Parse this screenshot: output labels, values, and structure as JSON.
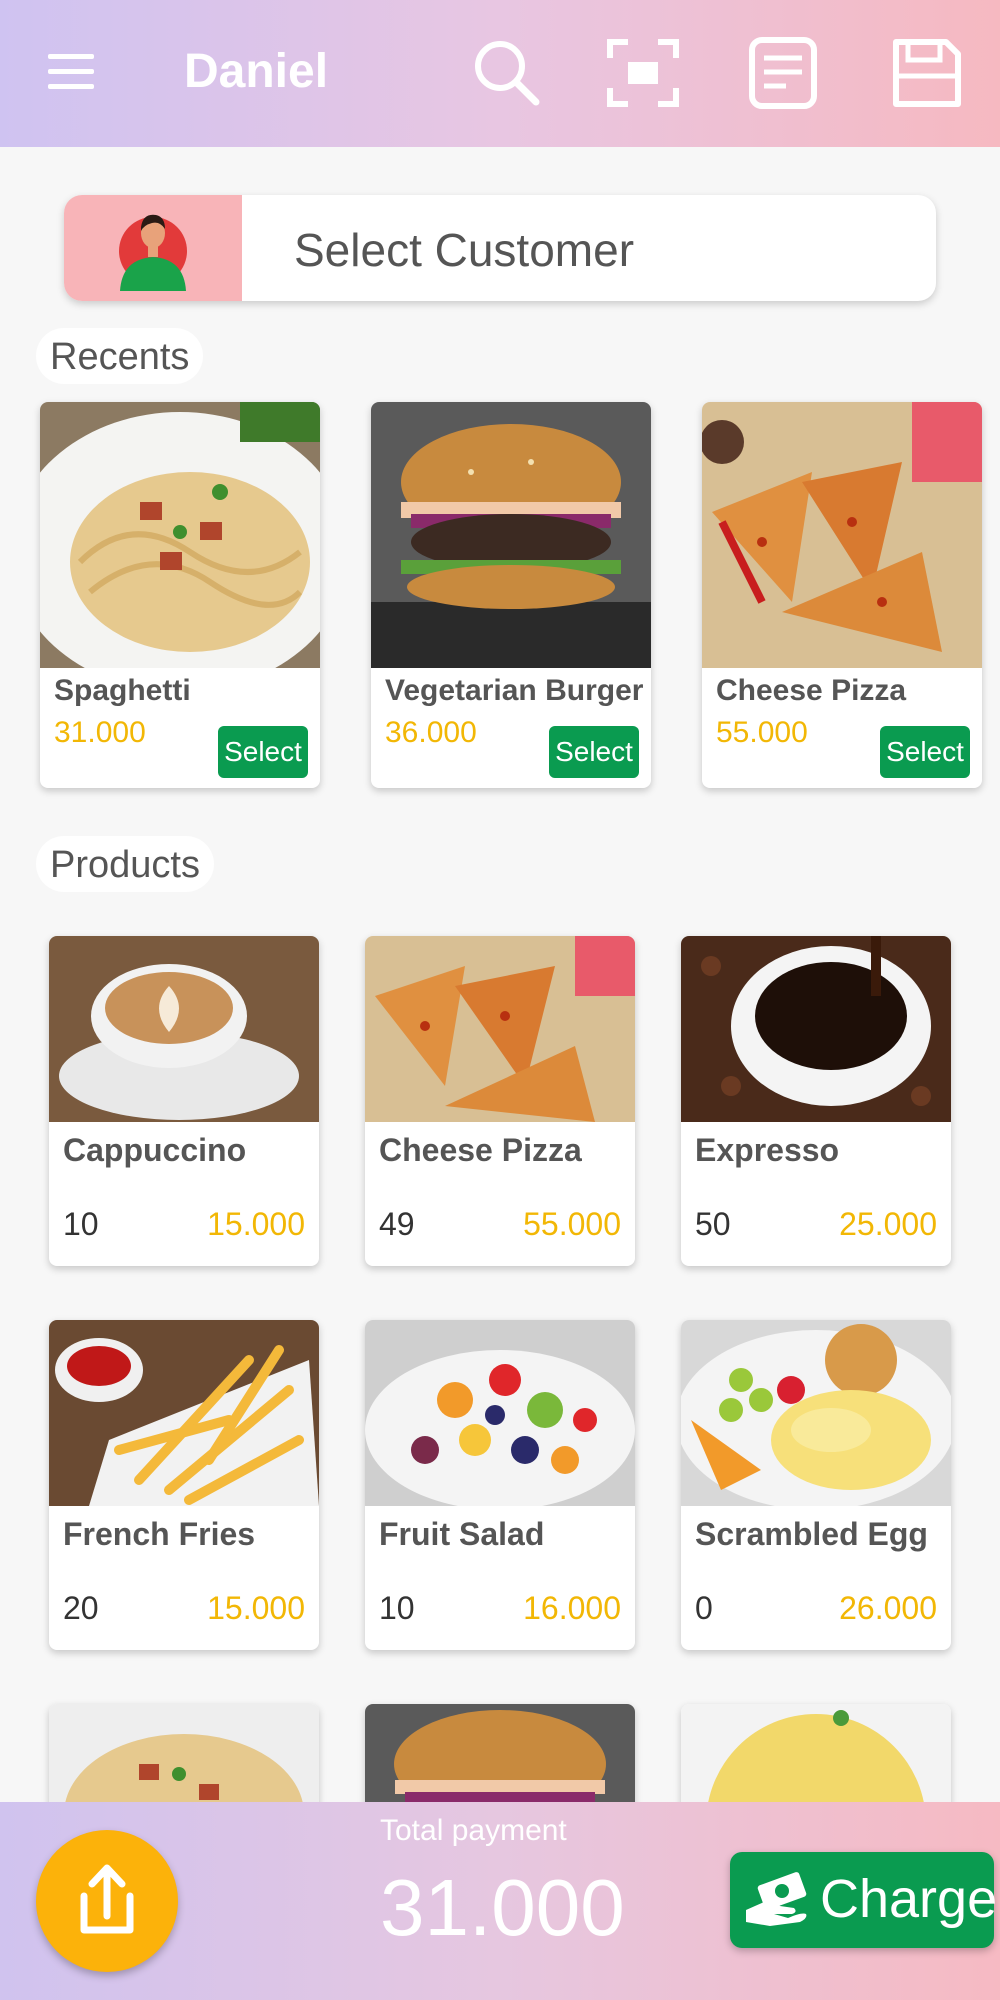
{
  "app": {
    "title": "Daniel"
  },
  "toolbar": {
    "icons": [
      "menu-icon",
      "search-icon",
      "scan-icon",
      "receipt-icon",
      "save-icon"
    ]
  },
  "customer": {
    "placeholder": "Select Customer"
  },
  "sections": {
    "recents": "Recents",
    "products": "Products"
  },
  "recents": [
    {
      "name": "Spaghetti",
      "price": "31.000",
      "action": "Select"
    },
    {
      "name": "Vegetarian Burger",
      "price": "36.000",
      "action": "Select"
    },
    {
      "name": "Cheese Pizza",
      "price": "55.000",
      "action": "Select"
    }
  ],
  "products": [
    {
      "name": "Cappuccino",
      "stock": "10",
      "price": "15.000"
    },
    {
      "name": "Cheese Pizza",
      "stock": "49",
      "price": "55.000"
    },
    {
      "name": "Expresso",
      "stock": "50",
      "price": "25.000"
    },
    {
      "name": "French Fries",
      "stock": "20",
      "price": "15.000"
    },
    {
      "name": "Fruit Salad",
      "stock": "10",
      "price": "16.000"
    },
    {
      "name": "Scrambled Egg",
      "stock": "0",
      "price": "26.000"
    }
  ],
  "footer": {
    "total_label": "Total payment",
    "total_value": "31.000",
    "charge_label": "Charge"
  },
  "colors": {
    "accent_green": "#0a9b50",
    "price_yellow": "#f2b705",
    "fab_orange": "#fcb20a",
    "avatar_pink": "#f8b4b8"
  }
}
